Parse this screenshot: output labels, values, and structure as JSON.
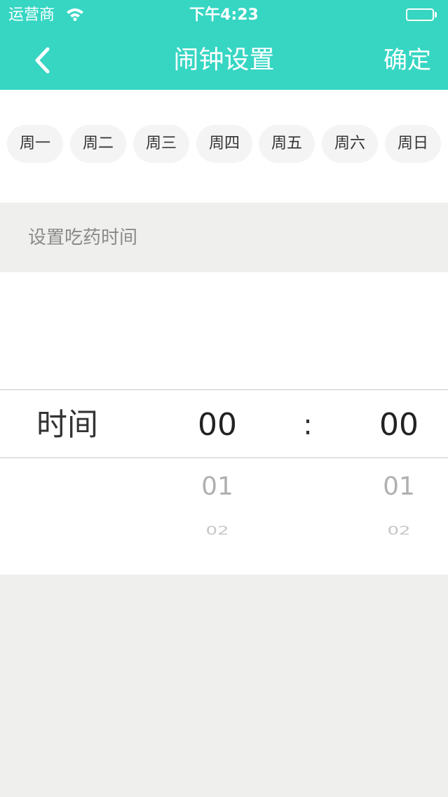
{
  "status_bar": {
    "carrier": "运营商",
    "time": "下午4:23"
  },
  "nav": {
    "title": "闹钟设置",
    "confirm_label": "确定"
  },
  "weekdays": [
    "周一",
    "周二",
    "周三",
    "周四",
    "周五",
    "周六",
    "周日"
  ],
  "section_label": "设置吃药时间",
  "picker": {
    "label": "时间",
    "separator": ":",
    "hour": {
      "selected": "00",
      "next": "01",
      "next2": "02"
    },
    "minute": {
      "selected": "00",
      "next": "01",
      "next2": "02"
    }
  },
  "colors": {
    "header": "#36d6c3",
    "background": "#efefee",
    "chip": "#f4f4f4"
  }
}
